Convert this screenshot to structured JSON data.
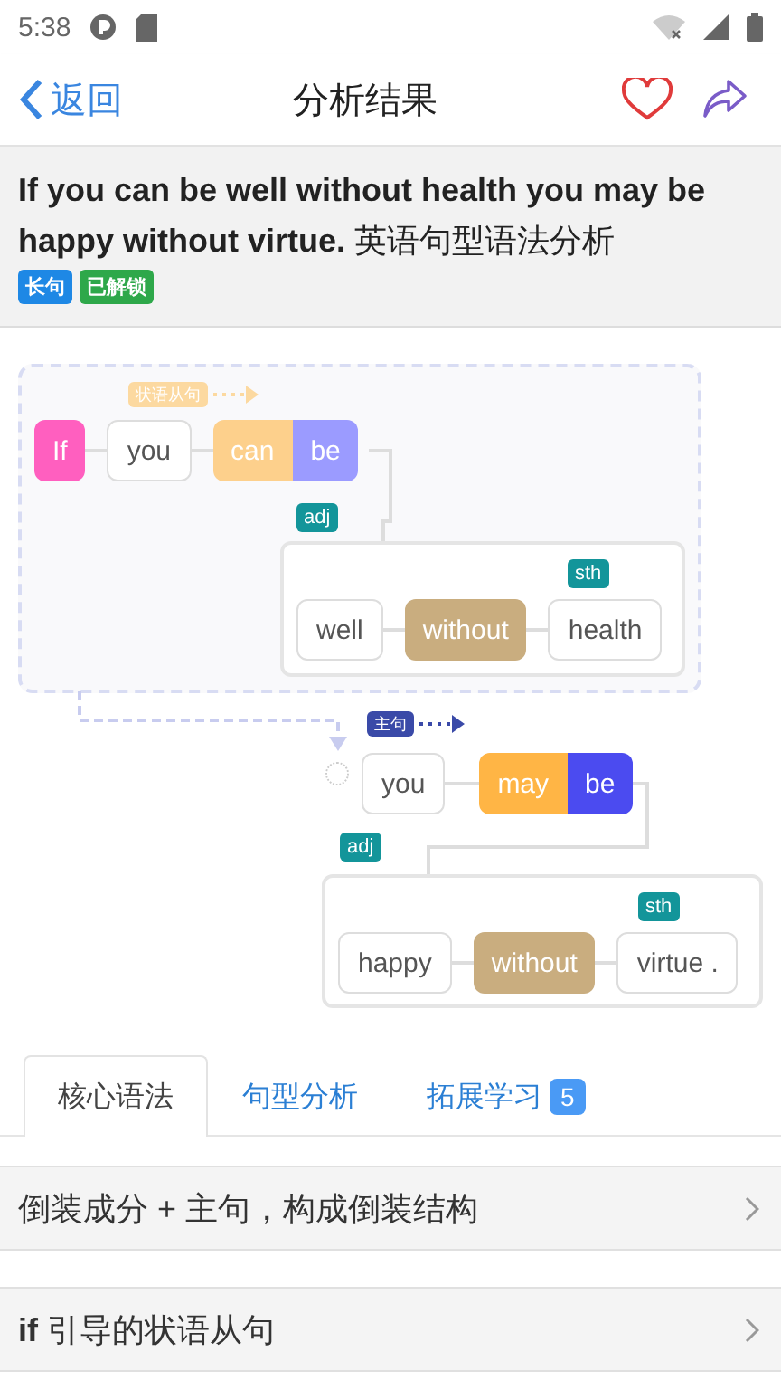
{
  "status_bar": {
    "time": "5:38"
  },
  "nav": {
    "back": "返回",
    "title": "分析结果"
  },
  "header": {
    "sentence": "**If you can be well without health you may be happy without virtue.** 英语句型语法分析",
    "tags": [
      {
        "label": "长句",
        "color": "#1e88e5"
      },
      {
        "label": "已解锁",
        "color": "#2ea84a"
      }
    ]
  },
  "diagram": {
    "clauses": [
      {
        "tag": "状语从句",
        "color": "#fcd9a0",
        "words": [
          {
            "text": "If",
            "color": "#ff5fbf"
          },
          {
            "text": "you"
          }
        ],
        "verb": [
          {
            "text": "can",
            "color": "#fdd08c"
          },
          {
            "text": "be",
            "color": "#9b9bff"
          }
        ],
        "complement": {
          "tag": "adj",
          "object_tag": "sth",
          "words": [
            {
              "text": "well"
            },
            {
              "text": "without",
              "color": "#c9ad7f"
            },
            {
              "text": "health"
            }
          ]
        }
      },
      {
        "tag": "主句",
        "color": "#3a4aa8",
        "words": [
          {
            "text": "you"
          }
        ],
        "verb": [
          {
            "text": "may",
            "color": "#ffb545"
          },
          {
            "text": "be",
            "color": "#4b4bf0"
          }
        ],
        "complement": {
          "tag": "adj",
          "object_tag": "sth",
          "words": [
            {
              "text": "happy"
            },
            {
              "text": "without",
              "color": "#c9ad7f"
            },
            {
              "text": "virtue ."
            }
          ]
        }
      }
    ]
  },
  "tabs": [
    {
      "label": "核心语法",
      "selected": true
    },
    {
      "label": "句型分析",
      "selected": false
    },
    {
      "label": "拓展学习",
      "selected": false,
      "badge": "5"
    }
  ],
  "items": [
    "倒装成分 + 主句，构成倒装结构",
    "**if** 引导的状语从句"
  ]
}
